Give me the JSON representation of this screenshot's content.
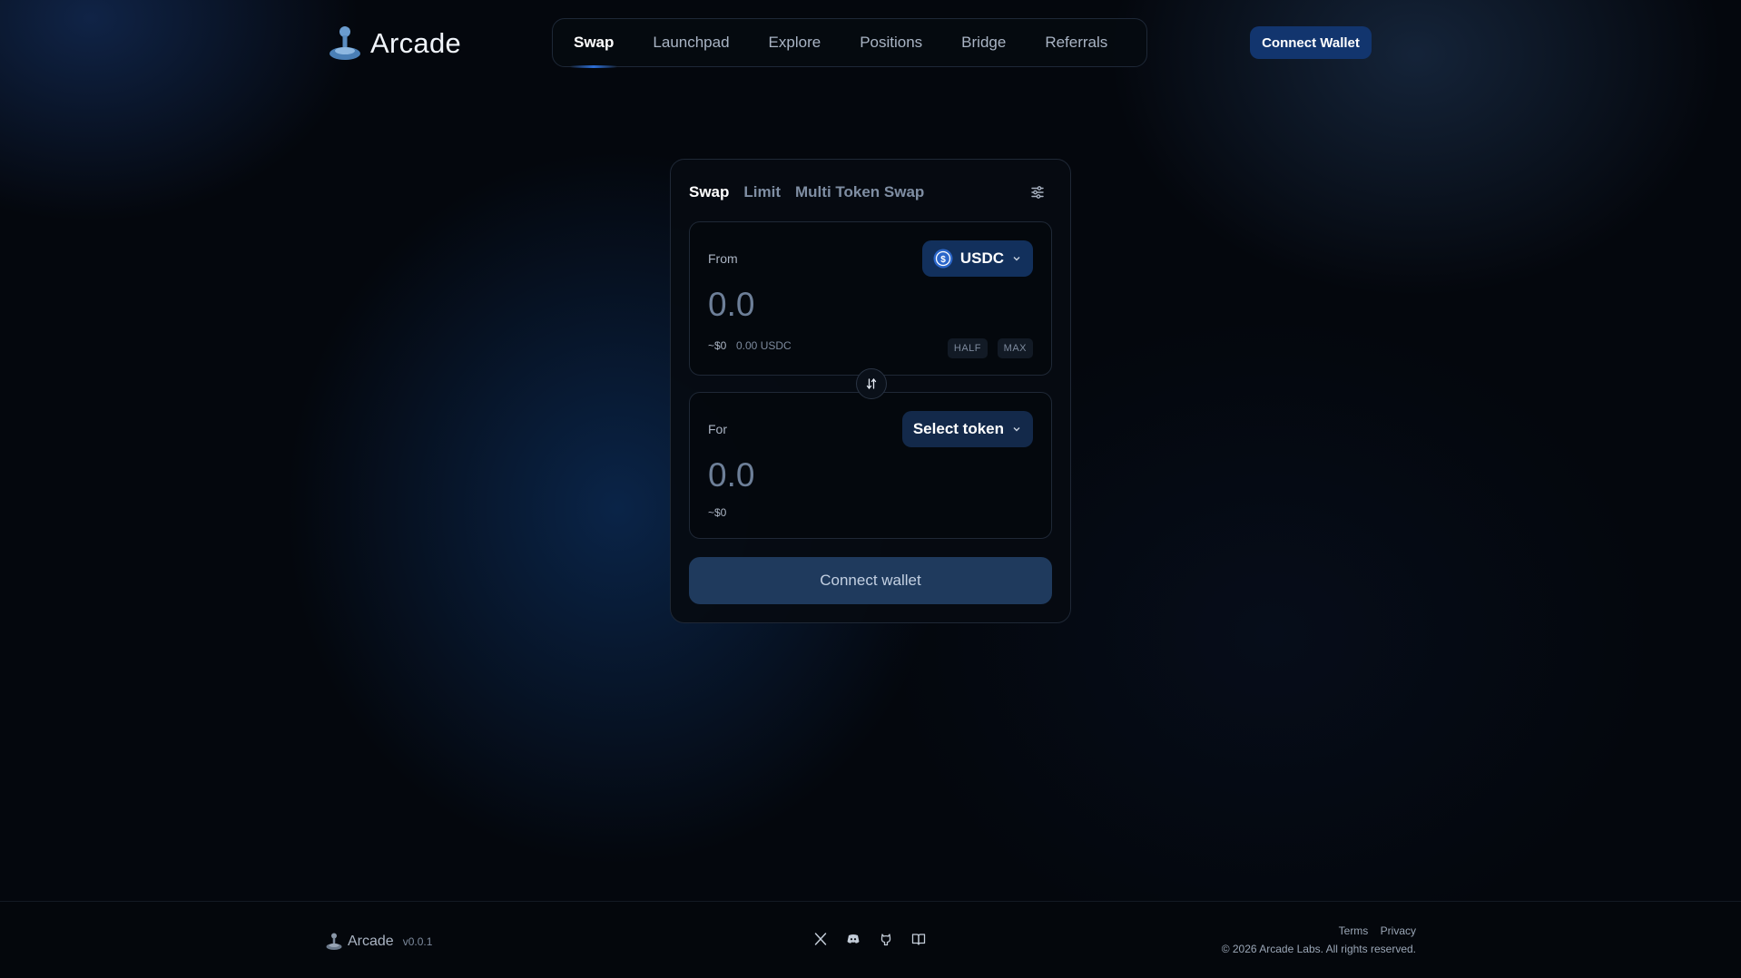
{
  "brand": {
    "name": "Arcade",
    "version": "v0.0.1"
  },
  "nav": {
    "items": [
      {
        "label": "Swap",
        "active": true
      },
      {
        "label": "Launchpad"
      },
      {
        "label": "Explore"
      },
      {
        "label": "Positions"
      },
      {
        "label": "Bridge"
      },
      {
        "label": "Referrals"
      }
    ]
  },
  "header": {
    "connect_label": "Connect Wallet"
  },
  "swap": {
    "tabs": [
      {
        "label": "Swap",
        "active": true
      },
      {
        "label": "Limit"
      },
      {
        "label": "Multi Token Swap"
      }
    ],
    "from": {
      "label": "From",
      "token": "USDC",
      "amount_placeholder": "0.0",
      "usd_value": "~$0",
      "balance": "0.00 USDC",
      "half_label": "HALF",
      "max_label": "MAX"
    },
    "to": {
      "label": "For",
      "token_button": "Select token",
      "amount_placeholder": "0.0",
      "usd_value": "~$0"
    },
    "connect_label": "Connect wallet"
  },
  "footer": {
    "links": [
      "Terms",
      "Privacy"
    ],
    "copyright": "© 2026 Arcade Labs. All rights reserved.",
    "socials": [
      "x-icon",
      "discord-icon",
      "github-icon",
      "docs-book-icon"
    ]
  },
  "colors": {
    "accent": "#12356e",
    "button_muted": "#1f3a5d",
    "background": "#04070d"
  }
}
